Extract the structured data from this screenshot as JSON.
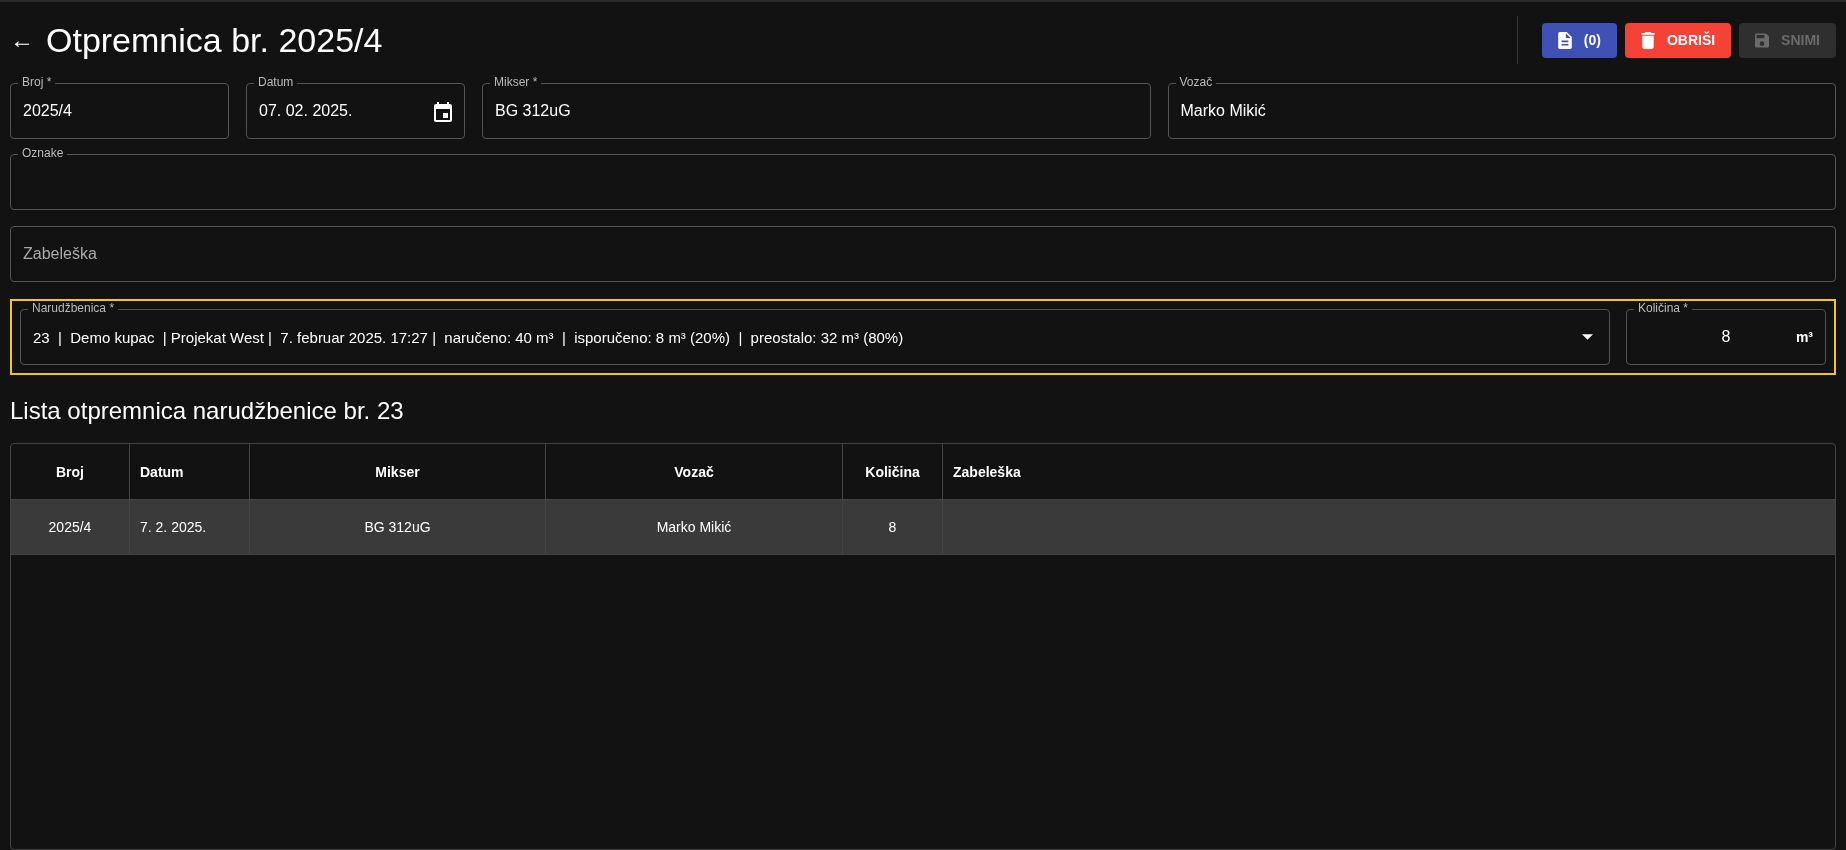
{
  "header": {
    "back_icon": "←",
    "title": "Otpremnica br. 2025/4"
  },
  "actions": [
    {
      "kind": "documents",
      "label": "(0)",
      "disabled": false
    },
    {
      "kind": "delete",
      "label": "OBRIŠI",
      "disabled": false
    },
    {
      "kind": "save",
      "label": "SNIMI",
      "disabled": true
    }
  ],
  "fields_row": [
    {
      "label": "Broj *",
      "value": "2025/4",
      "kind": "text"
    },
    {
      "label": "Datum",
      "value": "07. 02. 2025.",
      "kind": "date"
    },
    {
      "label": "Mikser *",
      "value": "BG 312uG",
      "kind": "text"
    },
    {
      "label": "Vozač",
      "value": "Marko Mikić",
      "kind": "text"
    }
  ],
  "oznake": {
    "label": "Oznake"
  },
  "zabeleska": {
    "placeholder": "Zabeleška"
  },
  "order": {
    "label": "Narudžbenica *",
    "value": "23  |  Demo kupac  | Projekat West |  7. februar 2025. 17:27 |  naručeno: 40 m³  |  isporučeno: 8 m³ (20%)  |  preostalo: 32 m³ (80%)",
    "quantity_label": "Količina *",
    "quantity": "8",
    "unit": "m³"
  },
  "list_title": "Lista otpremnica narudžbenice br. 23",
  "table": {
    "columns": [
      "Broj",
      "Datum",
      "Mikser",
      "Vozač",
      "Količina",
      "Zabeleška"
    ],
    "rows": [
      {
        "selected": true,
        "cells": [
          "2025/4",
          "7. 2. 2025.",
          "BG 312uG",
          "Marko Mikić",
          "8",
          ""
        ]
      }
    ]
  }
}
